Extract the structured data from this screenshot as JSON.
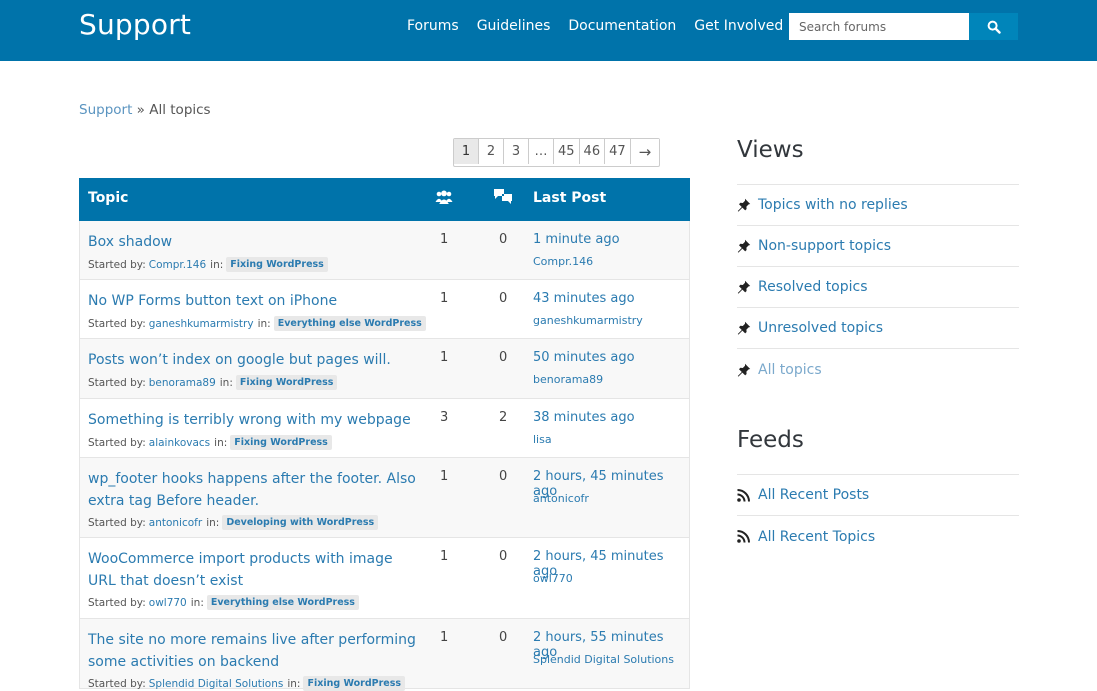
{
  "header": {
    "site_title": "Support",
    "nav": [
      "Forums",
      "Guidelines",
      "Documentation",
      "Get Involved"
    ],
    "search_placeholder": "Search forums"
  },
  "breadcrumb": {
    "root": "Support",
    "separator": "»",
    "current": "All topics"
  },
  "pagination": [
    "1",
    "2",
    "3",
    "…",
    "45",
    "46",
    "47",
    "→"
  ],
  "table": {
    "headers": {
      "topic": "Topic",
      "last_post": "Last Post"
    },
    "started_by": "Started by:",
    "in_label": "in:",
    "rows": [
      {
        "title": "Box shadow",
        "author": "Compr.146",
        "forum": "Fixing WordPress",
        "voices": "1",
        "replies": "0",
        "last_time": "1 minute ago",
        "last_author": "Compr.146"
      },
      {
        "title": "No WP Forms button text on iPhone",
        "author": "ganeshkumarmistry",
        "forum": "Everything else WordPress",
        "voices": "1",
        "replies": "0",
        "last_time": "43 minutes ago",
        "last_author": "ganeshkumarmistry"
      },
      {
        "title": "Posts won’t index on google but pages will.",
        "author": "benorama89",
        "forum": "Fixing WordPress",
        "voices": "1",
        "replies": "0",
        "last_time": "50 minutes ago",
        "last_author": "benorama89"
      },
      {
        "title": "Something is terribly wrong with my webpage",
        "author": "alainkovacs",
        "forum": "Fixing WordPress",
        "voices": "3",
        "replies": "2",
        "last_time": "38 minutes ago",
        "last_author": "lisa"
      },
      {
        "title": "wp_footer hooks happens after the footer. Also extra tag Before header.",
        "author": "antonicofr",
        "forum": "Developing with WordPress",
        "voices": "1",
        "replies": "0",
        "last_time": "2 hours, 45 minutes ago",
        "last_author": "antonicofr"
      },
      {
        "title": "WooCommerce import products with image URL that doesn’t exist",
        "author": "owl770",
        "forum": "Everything else WordPress",
        "voices": "1",
        "replies": "0",
        "last_time": "2 hours, 45 minutes ago",
        "last_author": "owl770"
      },
      {
        "title": "The site no more remains live after performing some activities on backend",
        "author": "Splendid Digital Solutions",
        "forum": "Fixing WordPress",
        "voices": "1",
        "replies": "0",
        "last_time": "2 hours, 55 minutes ago",
        "last_author": "Splendid Digital Solutions"
      }
    ]
  },
  "sidebar": {
    "views_title": "Views",
    "views": [
      "Topics with no replies",
      "Non-support topics",
      "Resolved topics",
      "Unresolved topics",
      "All topics"
    ],
    "feeds_title": "Feeds",
    "feeds": [
      "All Recent Posts",
      "All Recent Topics"
    ]
  },
  "colors": {
    "brand": "#0073aa",
    "link": "#2b7bb0",
    "search_button": "#0085ba"
  },
  "icons": {
    "search": "search-icon",
    "voices": "users-icon",
    "replies": "speech-bubbles-icon",
    "views": "pushpin-icon",
    "feeds": "rss-icon"
  }
}
